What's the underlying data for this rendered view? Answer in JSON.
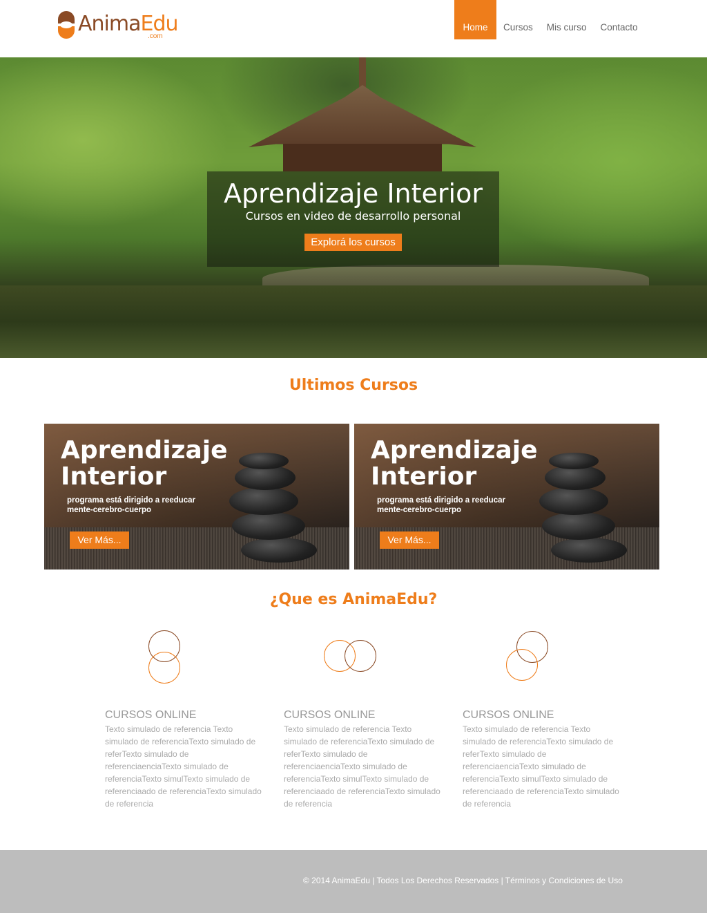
{
  "brand": {
    "name_part1": "Anima",
    "name_part2": "Edu",
    "suffix": ".com",
    "color_primary": "#ee7d1b",
    "color_secondary": "#8a4a25"
  },
  "nav": {
    "items": [
      {
        "label": "Home",
        "active": true
      },
      {
        "label": "Cursos",
        "active": false
      },
      {
        "label": "Mis curso",
        "active": false
      },
      {
        "label": "Contacto",
        "active": false
      }
    ]
  },
  "hero": {
    "title": "Aprendizaje Interior",
    "subtitle": "Cursos en video de desarrollo personal",
    "button": "Explorá los cursos"
  },
  "latest": {
    "heading": "Ultimos Cursos",
    "cards": [
      {
        "title_line1": "Aprendizaje",
        "title_line2": "Interior",
        "desc_line1": "programa está dirigido a reeducar",
        "desc_line2": "mente-cerebro-cuerpo",
        "button": "Ver Más..."
      },
      {
        "title_line1": "Aprendizaje",
        "title_line2": "Interior",
        "desc_line1": "programa está dirigido a reeducar",
        "desc_line2": "mente-cerebro-cuerpo",
        "button": "Ver Más..."
      }
    ]
  },
  "about": {
    "heading": "¿Que es AnimaEdu?",
    "features": [
      {
        "icon": "stacked-circles-icon",
        "title": "CURSOS ONLINE",
        "text": "Texto simulado de referencia Texto simulado de referenciaTexto simulado de referTexto simulado de referenciaenciaTexto simulado de referenciaTexto simulTexto simulado de referenciaado de referenciaTexto simulado de referencia"
      },
      {
        "icon": "overlapping-circles-icon",
        "title": "CURSOS ONLINE",
        "text": "Texto simulado de referencia Texto simulado de referenciaTexto simulado de referTexto simulado de referenciaenciaTexto simulado de referenciaTexto simulTexto simulado de referenciaado de referenciaTexto simulado de referencia"
      },
      {
        "icon": "diagonal-circles-icon",
        "title": "CURSOS ONLINE",
        "text": "Texto simulado de referencia Texto simulado de referenciaTexto simulado de referTexto simulado de referenciaenciaTexto simulado de referenciaTexto simulTexto simulado de referenciaado de referenciaTexto simulado de referencia"
      }
    ]
  },
  "footer": {
    "text": "© 2014 AnimaEdu | Todos Los Derechos Reservados | Términos y Condiciones de Uso"
  }
}
